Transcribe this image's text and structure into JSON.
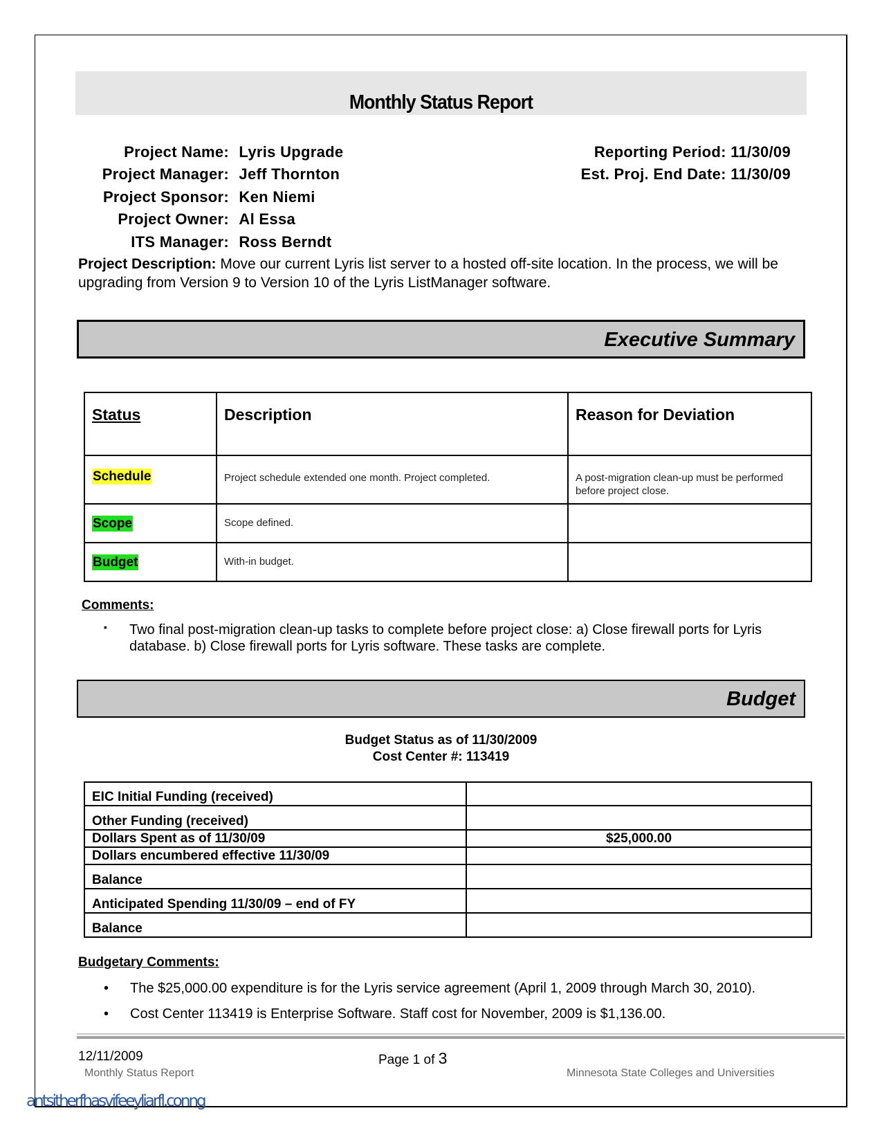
{
  "header": {
    "title": "Monthly Status Report"
  },
  "project_info": {
    "left": [
      {
        "label": "Project Name:",
        "value": "Lyris Upgrade"
      },
      {
        "label": "Project Manager:",
        "value": "Jeff Thornton"
      },
      {
        "label": "Project Sponsor:",
        "value": "Ken Niemi"
      },
      {
        "label": "Project Owner:",
        "value": "Al Essa"
      },
      {
        "label": "ITS Manager:",
        "value": "Ross Berndt"
      }
    ],
    "right": [
      {
        "label": "Reporting Period:",
        "value": "11/30/09"
      },
      {
        "label": "Est. Proj. End Date:",
        "value": "11/30/09"
      }
    ],
    "description_label": "Project Description:",
    "description_text": " Move our current Lyris list server to a hosted off-site location.  In the process, we will be upgrading from Version 9 to Version 10 of the Lyris ListManager software."
  },
  "executive_summary": {
    "title": "Executive Summary",
    "columns": [
      "Status",
      "Description",
      "Reason for Deviation"
    ],
    "rows": [
      {
        "status": "Schedule",
        "status_color": "#ffff33",
        "description": "Project schedule extended one month.  Project completed.",
        "reason": "A post-migration clean-up must be performed before project close."
      },
      {
        "status": "Scope",
        "status_color": "#22dd22",
        "description": "Scope defined.",
        "reason": ""
      },
      {
        "status": "Budget",
        "status_color": "#22dd22",
        "description": "With-in budget.",
        "reason": ""
      }
    ],
    "comments_label": "Comments:",
    "comments": [
      "Two final post-migration clean-up tasks to complete before project close:  a) Close firewall ports for Lyris database.  b) Close firewall ports for Lyris software.  These tasks are complete."
    ]
  },
  "budget": {
    "title": "Budget",
    "status_line": "Budget Status as of 11/30/2009",
    "cost_center_line": "Cost Center #: 113419",
    "rows": [
      {
        "label": "EIC Initial Funding (received)",
        "value": ""
      },
      {
        "label": "Other Funding (received)",
        "value": ""
      },
      {
        "label": "Dollars Spent as of 11/30/09",
        "value": "$25,000.00"
      },
      {
        "label": "Dollars encumbered effective 11/30/09",
        "value": ""
      },
      {
        "label": "Balance",
        "value": ""
      },
      {
        "label": "Anticipated Spending 11/30/09 – end of FY",
        "value": ""
      },
      {
        "label": "Balance",
        "value": ""
      }
    ],
    "comments_label": "Budgetary Comments:",
    "comments": [
      "The $25,000.00 expenditure is for the Lyris service agreement (April 1, 2009 through March 30, 2010).",
      "Cost Center 113419 is Enterprise Software.  Staff cost for November, 2009 is $1,136.00."
    ]
  },
  "footer": {
    "date": "12/11/2009",
    "doc_name": "Monthly Status Report",
    "page_prefix": "Page 1 of ",
    "page_total": "3",
    "organization": "Minnesota State Colleges and Universities"
  },
  "watermark": "antsitherfhasvifeeyliarfl.conng"
}
